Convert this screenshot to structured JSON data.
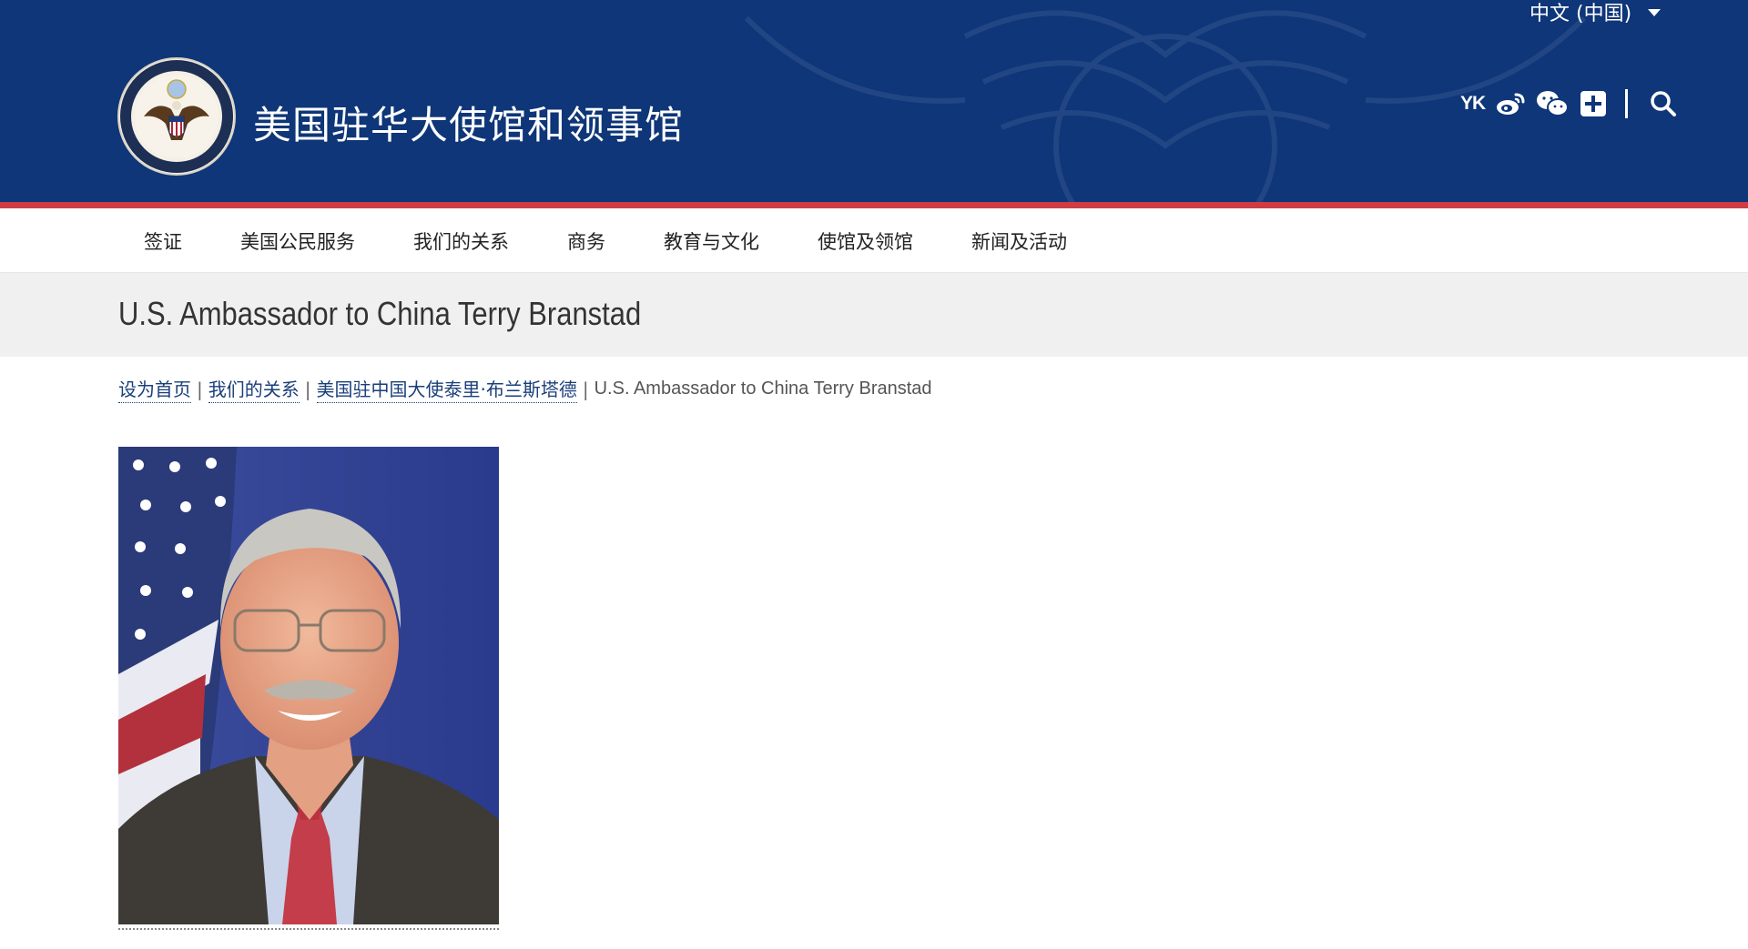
{
  "header": {
    "site_title": "美国驻华大使馆和领事馆",
    "language": "中文 (中国)",
    "social": {
      "youku_label": "YK",
      "icons": [
        "youku-icon",
        "weibo-icon",
        "wechat-icon",
        "plus-icon",
        "search-icon"
      ]
    },
    "colors": {
      "background": "#0e3678",
      "rule": "#cf3d44"
    }
  },
  "nav": {
    "items": [
      {
        "label": "签证"
      },
      {
        "label": "美国公民服务"
      },
      {
        "label": "我们的关系"
      },
      {
        "label": "商务"
      },
      {
        "label": "教育与文化"
      },
      {
        "label": "使馆及领馆"
      },
      {
        "label": "新闻及活动"
      }
    ]
  },
  "page": {
    "title": "U.S. Ambassador to China Terry Branstad"
  },
  "breadcrumb": {
    "links": [
      {
        "label": "设为首页"
      },
      {
        "label": "我们的关系"
      },
      {
        "label": "美国驻中国大使泰里·布兰斯塔德"
      }
    ],
    "separator": "|",
    "current": "U.S. Ambassador to China Terry Branstad"
  }
}
